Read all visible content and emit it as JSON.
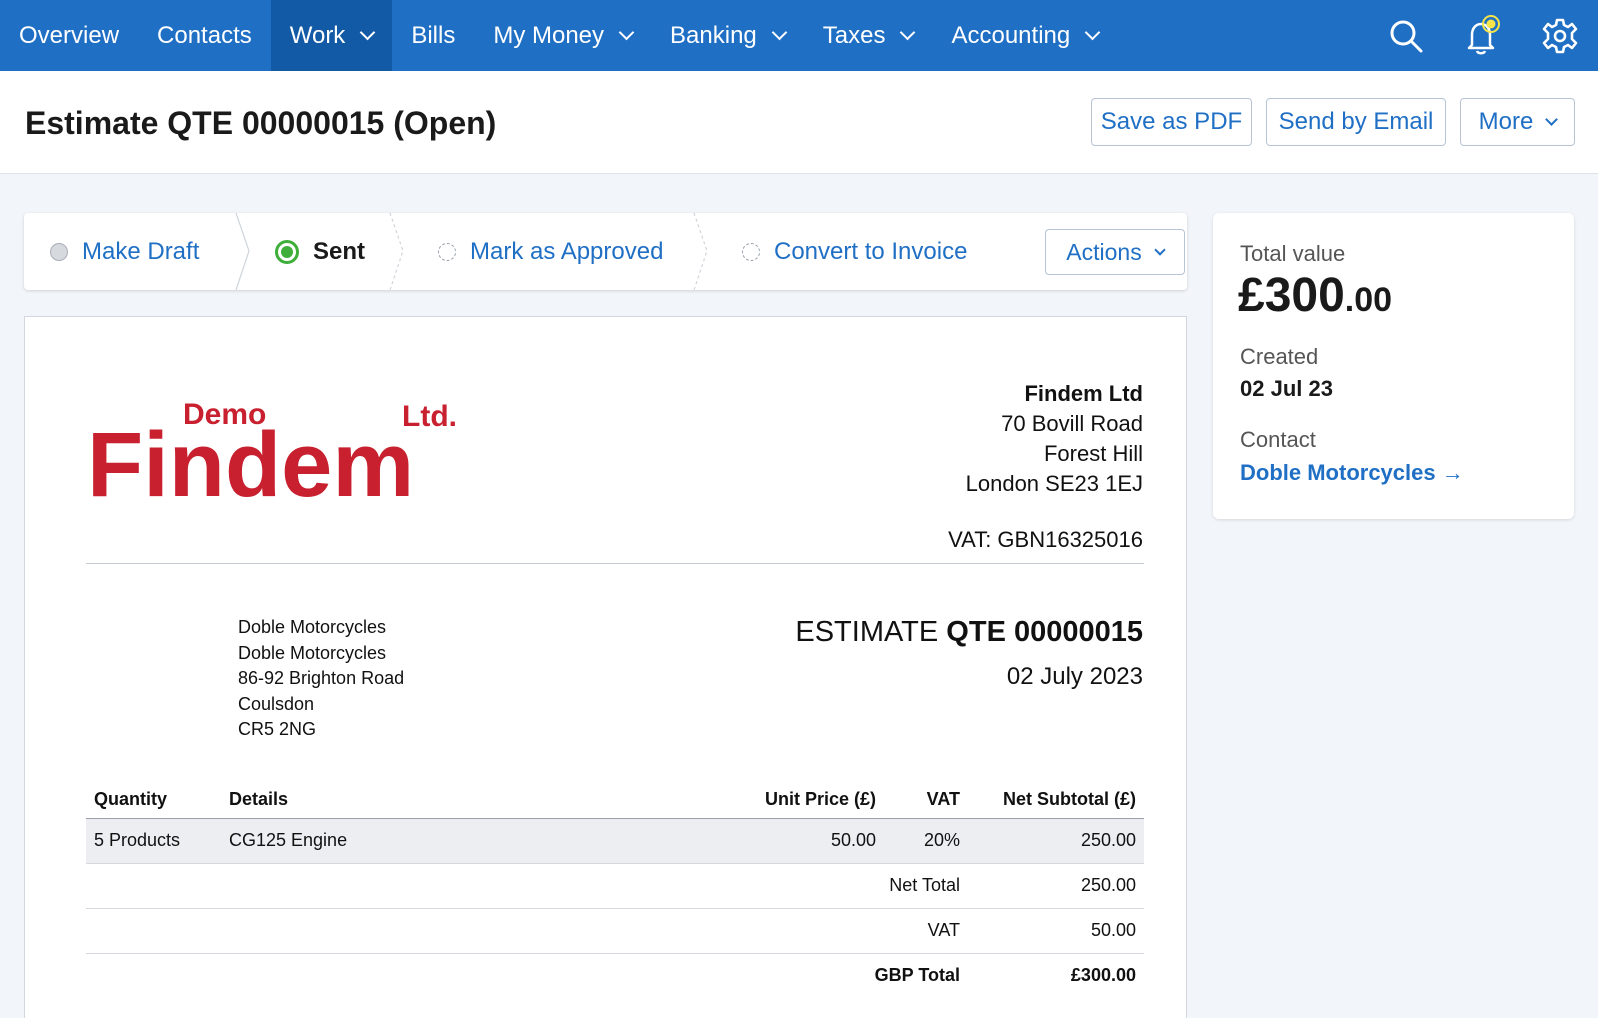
{
  "nav": {
    "items": [
      {
        "label": "Overview",
        "dropdown": false,
        "active": false
      },
      {
        "label": "Contacts",
        "dropdown": false,
        "active": false
      },
      {
        "label": "Work",
        "dropdown": true,
        "active": true
      },
      {
        "label": "Bills",
        "dropdown": false,
        "active": false
      },
      {
        "label": "My Money",
        "dropdown": true,
        "active": false
      },
      {
        "label": "Banking",
        "dropdown": true,
        "active": false
      },
      {
        "label": "Taxes",
        "dropdown": true,
        "active": false
      },
      {
        "label": "Accounting",
        "dropdown": true,
        "active": false
      }
    ],
    "icons": [
      "search-icon",
      "bell-icon",
      "gear-icon"
    ],
    "colors": {
      "bar": "#1f6fc5",
      "active": "#135aa6",
      "notification": "#f4e44a"
    }
  },
  "header": {
    "title": "Estimate QTE 00000015 (Open)",
    "save_pdf": "Save as PDF",
    "send_email": "Send by Email",
    "more": "More"
  },
  "status": {
    "steps": [
      {
        "label": "Make Draft",
        "state": "done"
      },
      {
        "label": "Sent",
        "state": "current"
      },
      {
        "label": "Mark as Approved",
        "state": "pending"
      },
      {
        "label": "Convert to Invoice",
        "state": "pending"
      }
    ],
    "actions": "Actions",
    "colors": {
      "current": "#3fae3a",
      "link": "#1f6fc5"
    }
  },
  "document": {
    "logo": {
      "demo": "Demo",
      "ltd": "Ltd.",
      "word": "Findem",
      "color": "#c8202f"
    },
    "company": {
      "name": "Findem Ltd",
      "address": [
        "70 Bovill Road",
        "Forest Hill",
        "London SE23 1EJ"
      ],
      "vat": "VAT: GBN16325016"
    },
    "customer": [
      "Doble Motorcycles",
      "Doble Motorcycles",
      "86-92 Brighton Road",
      "Coulsdon",
      "CR5 2NG"
    ],
    "estimate_label": "ESTIMATE",
    "estimate_number": "QTE 00000015",
    "date": "02 July 2023",
    "table": {
      "headers": [
        "Quantity",
        "Details",
        "Unit Price (£)",
        "VAT",
        "Net Subtotal (£)"
      ],
      "rows": [
        {
          "qty": "5 Products",
          "details": "CG125 Engine",
          "unit_price": "50.00",
          "vat": "20%",
          "subtotal": "250.00"
        }
      ],
      "totals": [
        {
          "label": "Net Total",
          "value": "250.00"
        },
        {
          "label": "VAT",
          "value": "50.00"
        },
        {
          "label": "GBP Total",
          "value": "£300.00"
        }
      ]
    }
  },
  "summary": {
    "total_label": "Total value",
    "total_main": "£300",
    "total_decimal": ".00",
    "created_label": "Created",
    "created_value": "02 Jul 23",
    "contact_label": "Contact",
    "contact_value": "Doble Motorcycles →"
  }
}
